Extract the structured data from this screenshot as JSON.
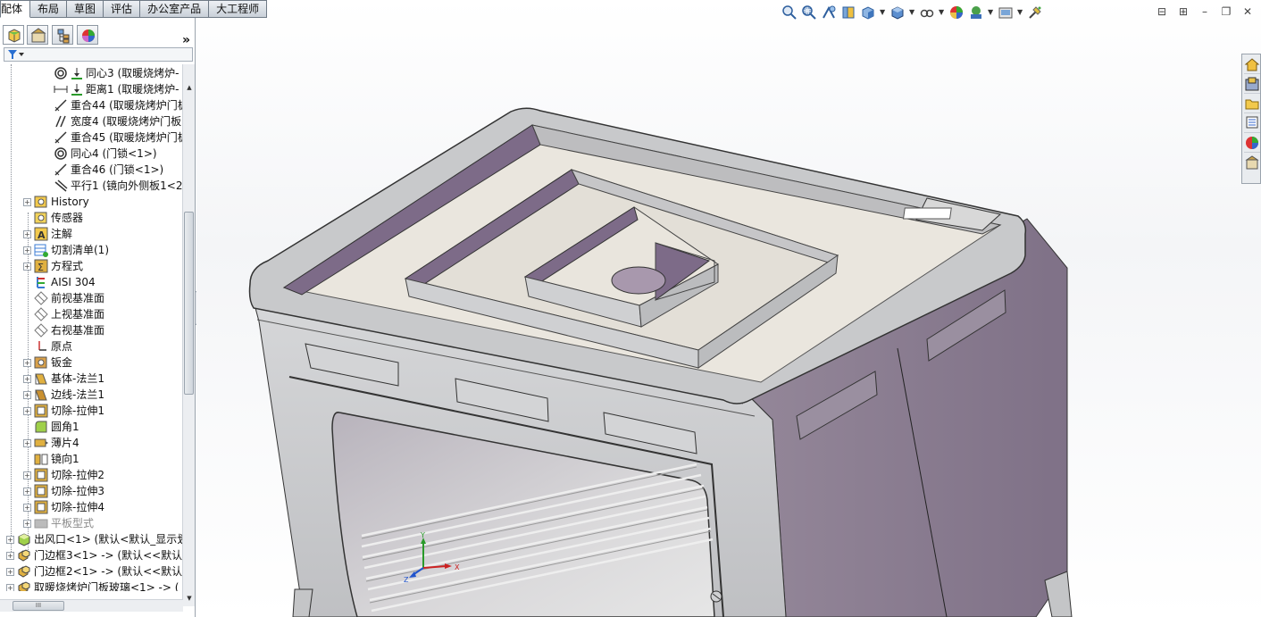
{
  "tabs": [
    {
      "label": "配体",
      "active": true
    },
    {
      "label": "布局"
    },
    {
      "label": "草图"
    },
    {
      "label": "评估"
    },
    {
      "label": "办公室产品"
    },
    {
      "label": "大工程师"
    }
  ],
  "panel": {
    "more_label": "»"
  },
  "tree": {
    "mates": [
      {
        "label": "同心3 (取暖烧烤炉-",
        "icon": "concentric-mate-icon"
      },
      {
        "label": "距离1 (取暖烧烤炉-",
        "icon": "distance-mate-icon"
      },
      {
        "label": "重合44 (取暖烧烤炉门板",
        "icon": "coincident-mate-icon"
      },
      {
        "label": "宽度4 (取暖烧烤炉门板",
        "icon": "width-mate-icon"
      },
      {
        "label": "重合45 (取暖烧烤炉门板",
        "icon": "coincident-mate-icon"
      },
      {
        "label": "同心4 (门锁<1>)",
        "icon": "concentric-mate-icon"
      },
      {
        "label": "重合46 (门锁<1>)",
        "icon": "coincident-mate-icon"
      },
      {
        "label": "平行1 (镜向外侧板1<2",
        "icon": "parallel-mate-icon"
      }
    ],
    "features": [
      {
        "label": "History",
        "icon": "history-icon",
        "expandable": true
      },
      {
        "label": "传感器",
        "icon": "sensor-icon",
        "expandable": false
      },
      {
        "label": "注解",
        "icon": "annotation-icon",
        "expandable": true
      },
      {
        "label": "切割清单(1)",
        "icon": "cut-list-icon",
        "expandable": true
      },
      {
        "label": "方程式",
        "icon": "equation-icon",
        "expandable": true
      },
      {
        "label": "AISI 304",
        "icon": "material-icon",
        "expandable": false
      },
      {
        "label": "前视基准面",
        "icon": "plane-icon",
        "expandable": false
      },
      {
        "label": "上视基准面",
        "icon": "plane-icon",
        "expandable": false
      },
      {
        "label": "右视基准面",
        "icon": "plane-icon",
        "expandable": false
      },
      {
        "label": "原点",
        "icon": "origin-icon",
        "expandable": false
      },
      {
        "label": "钣金",
        "icon": "sheet-metal-icon",
        "expandable": true
      },
      {
        "label": "基体-法兰1",
        "icon": "base-flange-icon",
        "expandable": true
      },
      {
        "label": "边线-法兰1",
        "icon": "edge-flange-icon",
        "expandable": true
      },
      {
        "label": "切除-拉伸1",
        "icon": "cut-extrude-icon",
        "expandable": true
      },
      {
        "label": "圆角1",
        "icon": "fillet-icon",
        "expandable": false
      },
      {
        "label": "薄片4",
        "icon": "tab-icon",
        "expandable": true
      },
      {
        "label": "镜向1",
        "icon": "mirror-icon",
        "expandable": false
      },
      {
        "label": "切除-拉伸2",
        "icon": "cut-extrude-icon",
        "expandable": true
      },
      {
        "label": "切除-拉伸3",
        "icon": "cut-extrude-icon",
        "expandable": true
      },
      {
        "label": "切除-拉伸4",
        "icon": "cut-extrude-icon",
        "expandable": true
      },
      {
        "label": "平板型式",
        "icon": "flat-pattern-icon",
        "expandable": true,
        "disabled": true
      }
    ],
    "components": [
      {
        "label": "出风口<1> (默认<默认_显示划",
        "icon": "part-icon"
      },
      {
        "label": "门边框3<1> -> (默认<<默认",
        "icon": "subassembly-icon"
      },
      {
        "label": "门边框2<1> -> (默认<<默认",
        "icon": "subassembly-icon"
      },
      {
        "label": "取暖烧烤炉门板玻璃<1> -> (",
        "icon": "subassembly-icon"
      }
    ]
  },
  "triad": {
    "x": "X",
    "y": "Y",
    "z": "Z"
  },
  "colors": {
    "body_outer": "#cfd0d2",
    "body_side": "#8d7f92",
    "inner_tray": "#e9e5dd",
    "accent_purple": "#7d6b88"
  }
}
